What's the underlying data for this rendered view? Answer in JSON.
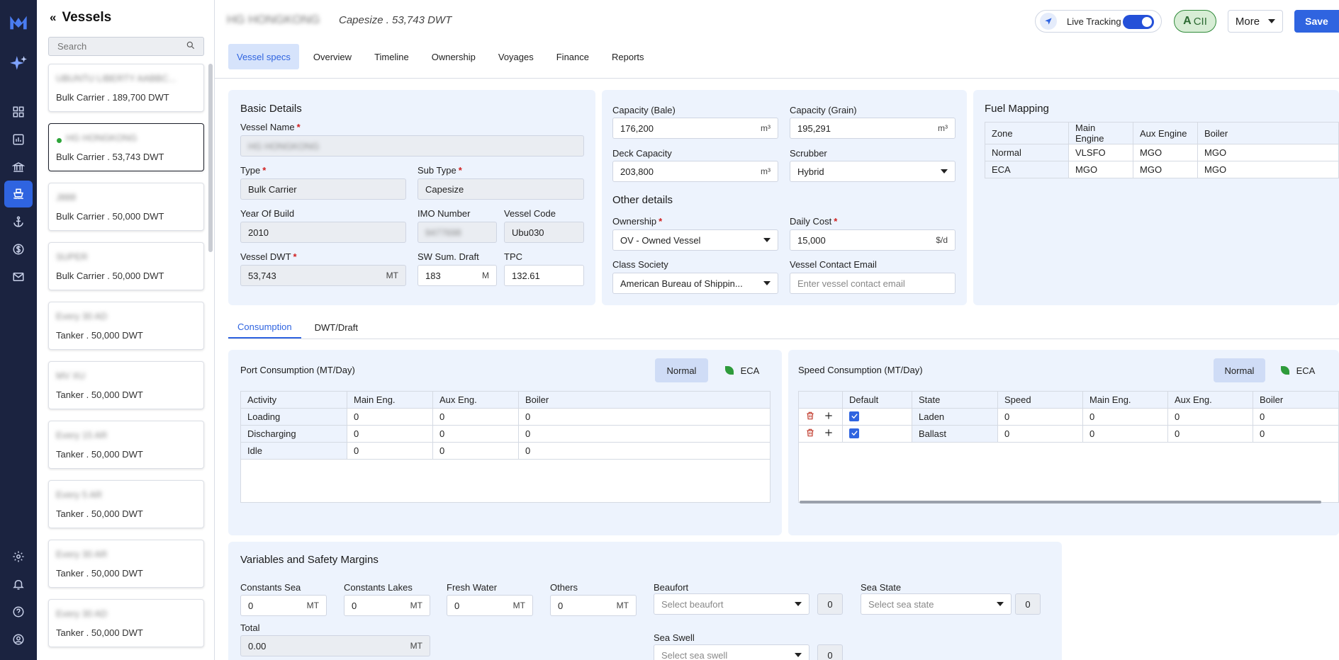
{
  "nav": {
    "icons": [
      "logo-icon",
      "ai-sparkle-icon",
      "dashboard-icon",
      "analytics-icon",
      "bank-icon",
      "ship-icon",
      "anchor-icon",
      "dollar-icon",
      "mail-icon",
      "settings-icon",
      "bell-icon",
      "help-icon",
      "user-icon"
    ],
    "active": "ship-icon"
  },
  "vessels_panel": {
    "title": "Vessels",
    "search_placeholder": "Search",
    "items": [
      {
        "name": "UBUNTU LIBERTY AABBC...",
        "sub": "Bulk Carrier . 189,700 DWT",
        "selected": false
      },
      {
        "name": "HG HONGKONG",
        "sub": "Bulk Carrier . 53,743 DWT",
        "selected": true
      },
      {
        "name": "J888",
        "sub": "Bulk Carrier . 50,000 DWT",
        "selected": false
      },
      {
        "name": "SUPER",
        "sub": "Bulk Carrier . 50,000 DWT",
        "selected": false
      },
      {
        "name": "Every 30 AD",
        "sub": "Tanker . 50,000 DWT",
        "selected": false
      },
      {
        "name": "MV XU",
        "sub": "Tanker . 50,000 DWT",
        "selected": false
      },
      {
        "name": "Every 15 AR",
        "sub": "Tanker . 50,000 DWT",
        "selected": false
      },
      {
        "name": "Every 5 AR",
        "sub": "Tanker . 50,000 DWT",
        "selected": false
      },
      {
        "name": "Every 30 AR",
        "sub": "Tanker . 50,000 DWT",
        "selected": false
      },
      {
        "name": "Every 30 AD",
        "sub": "Tanker . 50,000 DWT",
        "selected": false
      }
    ]
  },
  "header": {
    "vessel_name": "HG HONGKONG",
    "subtitle": "Capesize . 53,743 DWT",
    "live_tracking_label": "Live Tracking",
    "live_tracking_on": true,
    "cii_grade": "A",
    "cii_label": "CII",
    "more_label": "More",
    "save_label": "Save"
  },
  "tabs": [
    "Vessel specs",
    "Overview",
    "Timeline",
    "Ownership",
    "Voyages",
    "Finance",
    "Reports"
  ],
  "basic": {
    "title": "Basic Details",
    "vessel_name_label": "Vessel Name",
    "vessel_name_value": "HG HONGKONG",
    "type_label": "Type",
    "type_value": "Bulk Carrier",
    "subtype_label": "Sub Type",
    "subtype_value": "Capesize",
    "yob_label": "Year Of Build",
    "yob_value": "2010",
    "imo_label": "IMO Number",
    "imo_value": "9477698",
    "code_label": "Vessel Code",
    "code_value": "Ubu030",
    "dwt_label": "Vessel DWT",
    "dwt_value": "53,743",
    "dwt_unit": "MT",
    "draft_label": "SW Sum. Draft",
    "draft_value": "183",
    "draft_unit": "M",
    "tpc_label": "TPC",
    "tpc_value": "132.61"
  },
  "capacity": {
    "bale_label": "Capacity (Bale)",
    "bale_value": "176,200",
    "grain_label": "Capacity (Grain)",
    "grain_value": "195,291",
    "deck_label": "Deck Capacity",
    "deck_value": "203,800",
    "unit": "m³",
    "scrubber_label": "Scrubber",
    "scrubber_value": "Hybrid",
    "other_title": "Other details",
    "ownership_label": "Ownership",
    "ownership_value": "OV - Owned Vessel",
    "daily_cost_label": "Daily Cost",
    "daily_cost_value": "15,000",
    "daily_cost_unit": "$/d",
    "class_label": "Class Society",
    "class_value": "American Bureau of Shippin...",
    "email_label": "Vessel Contact Email",
    "email_placeholder": "Enter vessel contact email"
  },
  "fuel": {
    "title": "Fuel Mapping",
    "headers": [
      "Zone",
      "Main Engine",
      "Aux Engine",
      "Boiler"
    ],
    "rows": [
      [
        "Normal",
        "VLSFO",
        "MGO",
        "MGO"
      ],
      [
        "ECA",
        "MGO",
        "MGO",
        "MGO"
      ]
    ]
  },
  "section_tabs": [
    "Consumption",
    "DWT/Draft"
  ],
  "port": {
    "title": "Port Consumption (MT/Day)",
    "normal_label": "Normal",
    "eca_label": "ECA",
    "headers": [
      "Activity",
      "Main Eng.",
      "Aux Eng.",
      "Boiler"
    ],
    "rows": [
      [
        "Loading",
        "0",
        "0",
        "0"
      ],
      [
        "Discharging",
        "0",
        "0",
        "0"
      ],
      [
        "Idle",
        "0",
        "0",
        "0"
      ]
    ]
  },
  "speed": {
    "title": "Speed Consumption (MT/Day)",
    "normal_label": "Normal",
    "eca_label": "ECA",
    "headers": [
      "",
      "Default",
      "State",
      "Speed",
      "Main Eng.",
      "Aux Eng.",
      "Boiler"
    ],
    "rows": [
      [
        "Laden",
        "0",
        "0",
        "0",
        "0"
      ],
      [
        "Ballast",
        "0",
        "0",
        "0",
        "0"
      ]
    ]
  },
  "vars": {
    "title": "Variables and Safety Margins",
    "constants_sea_label": "Constants Sea",
    "constants_sea_value": "0",
    "constants_lakes_label": "Constants Lakes",
    "constants_lakes_value": "0",
    "fresh_water_label": "Fresh Water",
    "fresh_water_value": "0",
    "others_label": "Others",
    "others_value": "0",
    "unit": "MT",
    "total_label": "Total",
    "total_value": "0.00",
    "beaufort_label": "Beaufort",
    "beaufort_placeholder": "Select beaufort",
    "beaufort_count": "0",
    "sea_state_label": "Sea State",
    "sea_state_placeholder": "Select sea state",
    "sea_state_count": "0",
    "sea_swell_label": "Sea Swell",
    "sea_swell_placeholder": "Select sea swell",
    "sea_swell_count": "0"
  }
}
